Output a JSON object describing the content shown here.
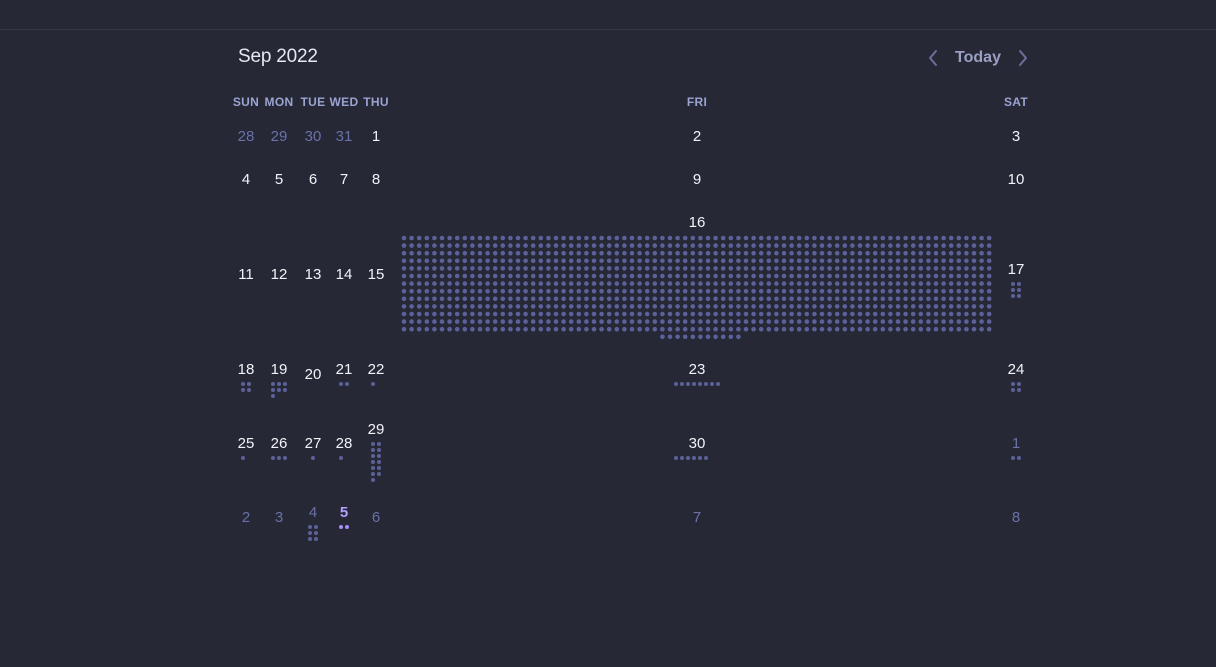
{
  "header": {
    "month_title": "Sep 2022",
    "prev_icon": "chevron-left-icon",
    "today_label": "Today",
    "next_icon": "chevron-right-icon"
  },
  "weekdays": [
    "SUN",
    "MON",
    "TUE",
    "WED",
    "THU",
    "FRI",
    "SAT"
  ],
  "colors": {
    "background": "#262836",
    "day_text": "#f2f3f8",
    "other_month_text": "#6a71a8",
    "dot": "#5c6299",
    "today_dot": "#a98cf5",
    "weekday_text": "#9ba3d1"
  },
  "weeks": [
    [
      {
        "label": "28",
        "other": true,
        "dots": 0
      },
      {
        "label": "29",
        "other": true,
        "dots": 0
      },
      {
        "label": "30",
        "other": true,
        "dots": 0
      },
      {
        "label": "31",
        "other": true,
        "dots": 0
      },
      {
        "label": "1",
        "dots": 0
      },
      {
        "label": "2",
        "dots": 0
      },
      {
        "label": "3",
        "dots": 0
      }
    ],
    [
      {
        "label": "4",
        "dots": 0
      },
      {
        "label": "5",
        "dots": 0
      },
      {
        "label": "6",
        "dots": 0
      },
      {
        "label": "7",
        "dots": 0
      },
      {
        "label": "8",
        "dots": 0
      },
      {
        "label": "9",
        "dots": 0
      },
      {
        "label": "10",
        "dots": 0
      }
    ],
    [
      {
        "label": "11",
        "dots": 0
      },
      {
        "label": "12",
        "dots": 0
      },
      {
        "label": "13",
        "dots": 0
      },
      {
        "label": "14",
        "dots": 0
      },
      {
        "label": "15",
        "dots": 0
      },
      {
        "label": "16",
        "dots": 1025
      },
      {
        "label": "17",
        "dots": 6
      }
    ],
    [
      {
        "label": "18",
        "dots": 4
      },
      {
        "label": "19",
        "dots": 7
      },
      {
        "label": "20",
        "dots": 0
      },
      {
        "label": "21",
        "dots": 2
      },
      {
        "label": "22",
        "dots": 1
      },
      {
        "label": "23",
        "dots": 8
      },
      {
        "label": "24",
        "dots": 4
      }
    ],
    [
      {
        "label": "25",
        "dots": 1
      },
      {
        "label": "26",
        "dots": 3
      },
      {
        "label": "27",
        "dots": 1
      },
      {
        "label": "28",
        "dots": 1
      },
      {
        "label": "29",
        "dots": 13
      },
      {
        "label": "30",
        "dots": 6
      },
      {
        "label": "1",
        "other": true,
        "dots": 2
      }
    ],
    [
      {
        "label": "2",
        "other": true,
        "dots": 0
      },
      {
        "label": "3",
        "other": true,
        "dots": 0
      },
      {
        "label": "4",
        "other": true,
        "dots": 6
      },
      {
        "label": "5",
        "other": true,
        "today": true,
        "dots": 2
      },
      {
        "label": "6",
        "other": true,
        "dots": 0
      },
      {
        "label": "7",
        "other": true,
        "dots": 0
      },
      {
        "label": "8",
        "other": true,
        "dots": 0
      }
    ]
  ]
}
